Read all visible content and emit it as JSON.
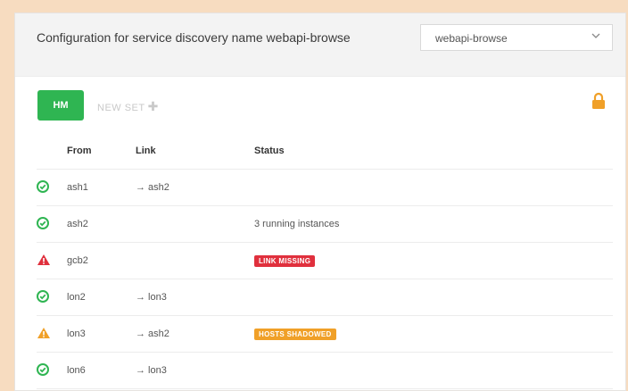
{
  "panel": {
    "title": "Configuration for service discovery name webapi-browse",
    "select_value": "webapi-browse"
  },
  "toolbar": {
    "set_label": "HM",
    "new_set_label": "NEW SET"
  },
  "table": {
    "headers": {
      "from": "From",
      "link": "Link",
      "status": "Status"
    },
    "rows": [
      {
        "state": "ok",
        "from": "ash1",
        "link": "→ ash2",
        "status": "",
        "badge": ""
      },
      {
        "state": "ok",
        "from": "ash2",
        "link": "",
        "status": "3 running instances",
        "badge": ""
      },
      {
        "state": "error",
        "from": "gcb2",
        "link": "",
        "status": "",
        "badge": "LINK MISSING"
      },
      {
        "state": "ok",
        "from": "lon2",
        "link": "→ lon3",
        "status": "",
        "badge": ""
      },
      {
        "state": "warning",
        "from": "lon3",
        "link": "→ ash2",
        "status": "",
        "badge": "HOSTS SHADOWED"
      },
      {
        "state": "ok",
        "from": "lon6",
        "link": "→ lon3",
        "status": "",
        "badge": ""
      }
    ]
  },
  "colors": {
    "ok": "#2fb552",
    "error": "#e0303d",
    "warning": "#f0a028",
    "lock": "#f0a028"
  },
  "icons": {
    "ok": "check-circle-icon",
    "error": "warning-triangle-icon",
    "warning": "warning-triangle-icon",
    "lock": "lock-icon",
    "select": "chevron-down-icon",
    "new_set": "plus-icon"
  }
}
